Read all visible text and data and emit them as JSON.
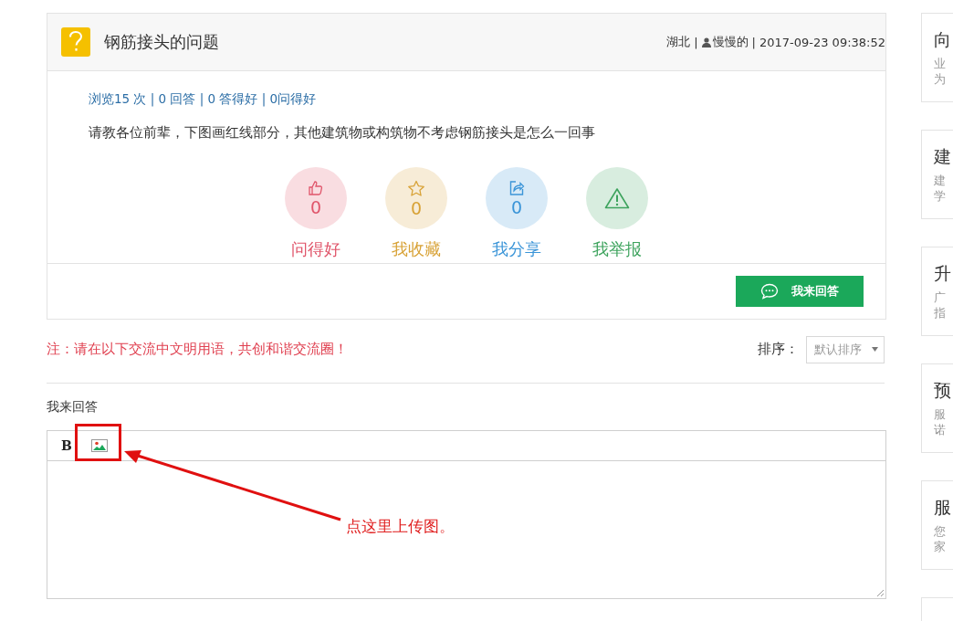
{
  "question": {
    "title": "钢筋接头的问题",
    "meta": [
      {
        "kind": "text",
        "text": "湖北"
      },
      {
        "kind": "sep",
        "text": "|"
      },
      {
        "kind": "user",
        "text": "慢慢的"
      },
      {
        "kind": "sep",
        "text": "|"
      },
      {
        "kind": "text",
        "text": "2017-09-23 09:38:52"
      }
    ],
    "stats": "浏览15 次 | 0 回答 | 0 答得好 | 0问得好",
    "body": "请教各位前辈，下图画红线部分，其他建筑物或构筑物不考虑钢筋接头是怎么一回事",
    "actions": [
      {
        "kind": "like",
        "count": "0",
        "label": "问得好",
        "color": "#e0566b"
      },
      {
        "kind": "favorite",
        "count": "0",
        "label": "我收藏",
        "color": "#d8a236"
      },
      {
        "kind": "share",
        "count": "0",
        "label": "我分享",
        "color": "#3b95d8"
      },
      {
        "kind": "report",
        "label": "我举报",
        "color": "#3da35d"
      }
    ],
    "answer_button": "我来回答"
  },
  "notice": "注：请在以下交流中文明用语，共创和谐交流圈！",
  "sort": {
    "label": "排序：",
    "value": "默认排序"
  },
  "editor": {
    "label": "我来回答",
    "tools": [
      {
        "kind": "bold",
        "text": "B"
      },
      {
        "kind": "image"
      }
    ]
  },
  "annotation": "点这里上传图。",
  "sidebar": [
    {
      "title": "向",
      "lines": [
        "业",
        "为"
      ]
    },
    {
      "title": "建",
      "lines": [
        "建",
        "学"
      ]
    },
    {
      "title": "升",
      "lines": [
        "广",
        "指"
      ]
    },
    {
      "title": "预",
      "lines": [
        "服",
        "诺"
      ]
    },
    {
      "title": "服",
      "lines": [
        "您",
        "家"
      ]
    }
  ]
}
